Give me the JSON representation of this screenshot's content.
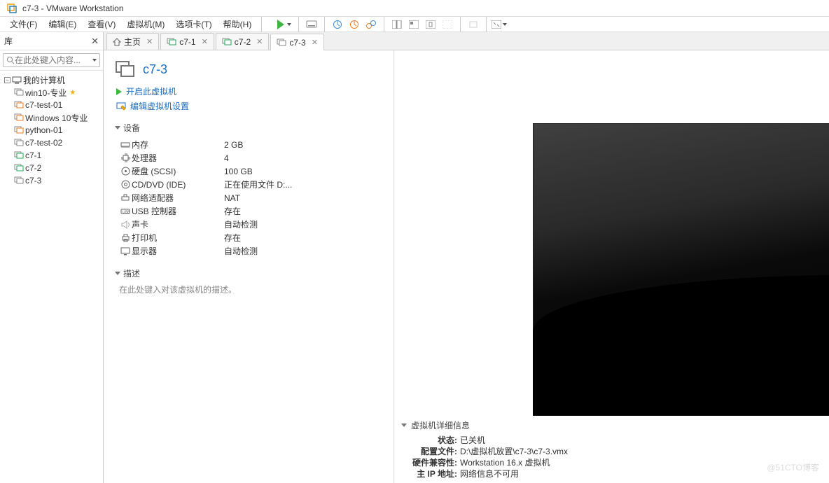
{
  "title": "c7-3 - VMware Workstation",
  "menus": [
    "文件(F)",
    "编辑(E)",
    "查看(V)",
    "虚拟机(M)",
    "选项卡(T)",
    "帮助(H)"
  ],
  "sidebar": {
    "header": "库",
    "search_placeholder": "在此处键入内容...",
    "root": "我的计算机",
    "items": [
      {
        "label": "win10-专业",
        "color": "#888",
        "star": true
      },
      {
        "label": "c7-test-01",
        "color": "#e67e22"
      },
      {
        "label": "Windows 10专业",
        "color": "#e67e22"
      },
      {
        "label": "python-01",
        "color": "#e67e22"
      },
      {
        "label": "c7-test-02",
        "color": "#888"
      },
      {
        "label": "c7-1",
        "color": "#26a65b"
      },
      {
        "label": "c7-2",
        "color": "#26a65b"
      },
      {
        "label": "c7-3",
        "color": "#888"
      }
    ]
  },
  "tabs": {
    "home": "主页",
    "items": [
      {
        "label": "c7-1",
        "color": "#26a65b"
      },
      {
        "label": "c7-2",
        "color": "#26a65b"
      },
      {
        "label": "c7-3",
        "color": "#888",
        "active": true
      }
    ]
  },
  "vm": {
    "name": "c7-3",
    "action_start": "开启此虚拟机",
    "action_edit": "编辑虚拟机设置",
    "section_devices": "设备",
    "devices": [
      {
        "icon": "memory",
        "name": "内存",
        "value": "2 GB"
      },
      {
        "icon": "cpu",
        "name": "处理器",
        "value": "4"
      },
      {
        "icon": "disk",
        "name": "硬盘 (SCSI)",
        "value": "100 GB"
      },
      {
        "icon": "cd",
        "name": "CD/DVD (IDE)",
        "value": "正在使用文件 D:..."
      },
      {
        "icon": "net",
        "name": "网络适配器",
        "value": "NAT"
      },
      {
        "icon": "usb",
        "name": "USB 控制器",
        "value": "存在"
      },
      {
        "icon": "sound",
        "name": "声卡",
        "value": "自动检测"
      },
      {
        "icon": "printer",
        "name": "打印机",
        "value": "存在"
      },
      {
        "icon": "display",
        "name": "显示器",
        "value": "自动检测"
      }
    ],
    "section_desc": "描述",
    "desc_placeholder": "在此处键入对该虚拟机的描述。"
  },
  "meta": {
    "header": "虚拟机详细信息",
    "rows": [
      {
        "label": "状态:",
        "value": "已关机"
      },
      {
        "label": "配置文件:",
        "value": "D:\\虚拟机放置\\c7-3\\c7-3.vmx"
      },
      {
        "label": "硬件兼容性:",
        "value": "Workstation 16.x 虚拟机"
      },
      {
        "label": "主 IP 地址:",
        "value": "网络信息不可用"
      }
    ]
  },
  "watermark": "@51CTO博客"
}
